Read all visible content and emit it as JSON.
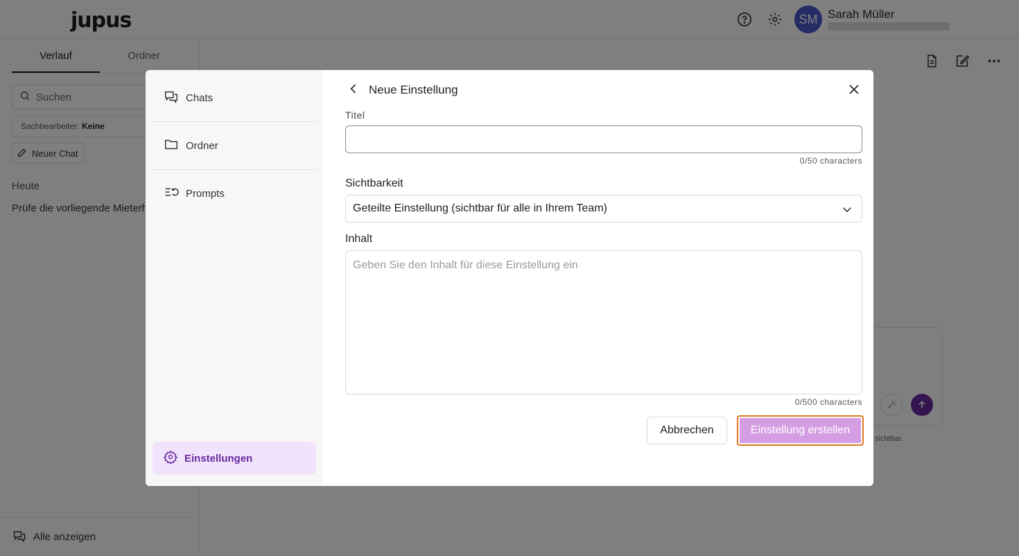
{
  "app": {
    "logo": "jupus",
    "user": {
      "initials": "SM",
      "name": "Sarah Müller"
    }
  },
  "sidebar": {
    "tabs": [
      {
        "label": "Verlauf"
      },
      {
        "label": "Ordner"
      }
    ],
    "search_placeholder": "Suchen",
    "filter": {
      "label": "Sachbearbeiter:",
      "value": "Keine"
    },
    "new_chat": "Neuer Chat",
    "section_today": "Heute",
    "chat_item": "Prüfe die vorliegende Mieterh",
    "show_all": "Alle anzeigen"
  },
  "main": {
    "composer_note": "sichtbar."
  },
  "modal": {
    "nav": {
      "items": [
        {
          "label": "Chats",
          "icon": "chats-icon"
        },
        {
          "label": "Ordner",
          "icon": "folder-icon"
        },
        {
          "label": "Prompts",
          "icon": "prompts-icon"
        }
      ],
      "settings": {
        "label": "Einstellungen",
        "icon": "gear-icon"
      }
    },
    "header_title": "Neue Einstellung",
    "form": {
      "title_label": "Titel",
      "title_value": "",
      "title_counter": "0/50 characters",
      "visibility_label": "Sichtbarkeit",
      "visibility_value": "Geteilte Einstellung (sichtbar für alle in Ihrem Team)",
      "content_label": "Inhalt",
      "content_placeholder": "Geben Sie den Inhalt für diese Einstellung ein",
      "content_counter": "0/500 characters"
    },
    "buttons": {
      "cancel": "Abbrechen",
      "create": "Einstellung erstellen"
    }
  },
  "colors": {
    "accent": "#6a2aa0",
    "accent_soft": "#f1e3fb",
    "create_button": "#d59ee4",
    "focus_ring": "#e07820",
    "avatar": "#4b57c9"
  }
}
